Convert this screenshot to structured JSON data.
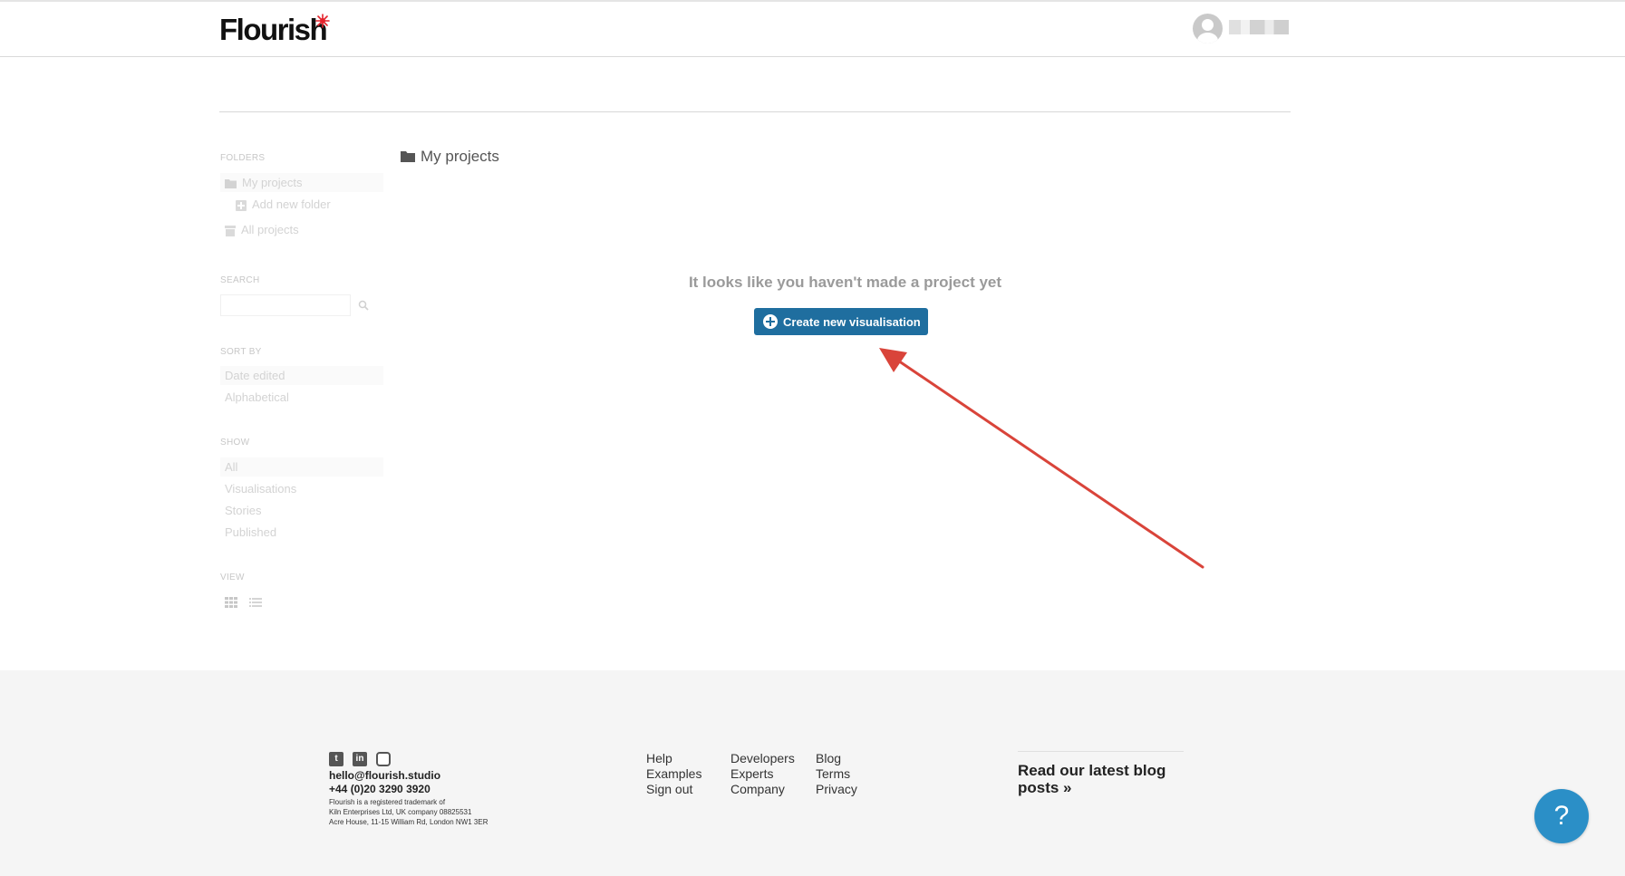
{
  "header": {
    "logo_text": "Flourish",
    "user_name": ""
  },
  "sidebar": {
    "folders_label": "FOLDERS",
    "folders": [
      {
        "label": "My projects",
        "active": true
      },
      {
        "label": "Add new folder"
      },
      {
        "label": "All projects"
      }
    ],
    "search_label": "SEARCH",
    "search_placeholder": "",
    "sort_label": "SORT BY",
    "sort_options": [
      {
        "label": "Date edited",
        "active": true
      },
      {
        "label": "Alphabetical"
      }
    ],
    "show_label": "SHOW",
    "show_options": [
      {
        "label": "All",
        "active": true
      },
      {
        "label": "Visualisations"
      },
      {
        "label": "Stories"
      },
      {
        "label": "Published"
      }
    ],
    "view_label": "VIEW"
  },
  "main": {
    "title": "My projects",
    "empty_message": "It looks like you haven't made a project yet",
    "create_button": "Create new visualisation"
  },
  "footer": {
    "email": "hello@flourish.studio",
    "phone": "+44 (0)20 3290 3920",
    "legal_lines": [
      "Flourish is a registered trademark of",
      "Kiln Enterprises Ltd, UK company 08825531",
      "Acre House, 11-15 William Rd, London NW1 3ER"
    ],
    "links_col1": [
      "Help",
      "Examples",
      "Sign out"
    ],
    "links_col2": [
      "Developers",
      "Experts",
      "Company"
    ],
    "links_col3": [
      "Blog",
      "Terms",
      "Privacy"
    ],
    "blog_promo": "Read our latest blog posts »"
  },
  "help_button": "?",
  "colors": {
    "primary": "#1f6e9f",
    "help": "#2b8fc7",
    "annotation": "#d9443a",
    "logo_star": "#e4222b"
  }
}
